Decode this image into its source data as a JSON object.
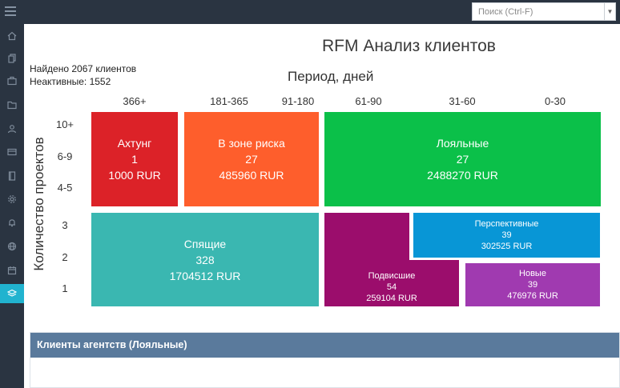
{
  "search": {
    "placeholder": "Поиск (Ctrl-F)"
  },
  "page": {
    "title": "RFM Анализ клиентов",
    "found": "Найдено 2067 клиентов",
    "inactive": "Неактивные: 1552"
  },
  "axes": {
    "x_title": "Период, дней",
    "y_title": "Количество проектов",
    "columns": [
      "366+",
      "181-365",
      "91-180",
      "61-90",
      "31-60",
      "0-30"
    ],
    "rows": [
      "10+",
      "6-9",
      "4-5",
      "3",
      "2",
      "1"
    ]
  },
  "segments": [
    {
      "name": "Ахтунг",
      "count": "1",
      "amount": "1000 RUR",
      "color": "#dc2228"
    },
    {
      "name": "В зоне риска",
      "count": "27",
      "amount": "485960 RUR",
      "color": "#fe5e2c"
    },
    {
      "name": "Лояльные",
      "count": "27",
      "amount": "2488270 RUR",
      "color": "#0bc049"
    },
    {
      "name": "Спящие",
      "count": "328",
      "amount": "1704512 RUR",
      "color": "#3ab7b1"
    },
    {
      "name": "Перспективные",
      "count": "39",
      "amount": "302525 RUR",
      "color": "#0896d6"
    },
    {
      "name": "Подвисшие",
      "count": "54",
      "amount": "259104 RUR",
      "color": "#9b0d6c"
    },
    {
      "name": "Новые",
      "count": "39",
      "amount": "476976 RUR",
      "color": "#a03ab0"
    }
  ],
  "panel": {
    "title": "Клиенты агентств (Лояльные)"
  },
  "sidebar": {
    "icons": [
      "home-icon",
      "documents-icon",
      "briefcase-icon",
      "folder-icon",
      "users-icon",
      "card-icon",
      "book-icon",
      "settings-icon",
      "bell-icon",
      "globe-icon",
      "calendar-icon",
      "layers-icon"
    ],
    "active": "layers-icon"
  },
  "colors": {
    "topbar": "#2a3441",
    "accent": "#21b3cf",
    "panel_header": "#5a7a9c"
  }
}
